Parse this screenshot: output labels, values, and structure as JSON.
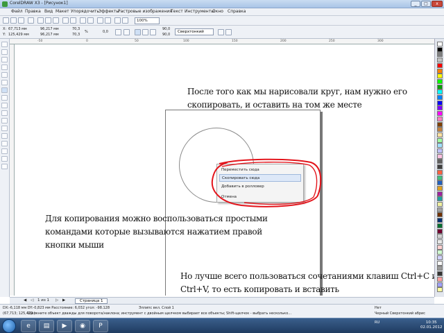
{
  "window": {
    "title": "CorelDRAW X3 - [Рисунок1]",
    "minimize": "_",
    "maximize": "□",
    "close": "x"
  },
  "menu": [
    "Файл",
    "Правка",
    "Вид",
    "Макет",
    "Упорядочить",
    "Эффекты",
    "Растровые изображения",
    "Текст",
    "Инструменты",
    "Окно",
    "Справка"
  ],
  "toolbar": {
    "zoom": "100%"
  },
  "propbar": {
    "x": "67,713 мм",
    "y": "125,429 мм",
    "w": "96,217 мм",
    "h": "96,217 мм",
    "sx": "70,3",
    "sy": "70,3",
    "angle": "0,0",
    "deg1": "90,0",
    "deg2": "90,0",
    "outline": "Сверхтонкий"
  },
  "slide": {
    "note1": "После того как мы нарисовали круг, нам нужно его скопировать, и оставить на том же месте",
    "note2": "Для копирования можно воспользоваться простыми командами которые вызываются нажатием правой кнопки мыши",
    "note3": "Но лучше всего пользоваться сочетаниями клавиш Ctrl+C и Ctrl+V, то есть копировать и вставить"
  },
  "context_menu": [
    "Переместить сюда",
    "Скопировать сюда",
    "Добавить в ролловер",
    "Отмена"
  ],
  "pagenav": {
    "counter": "1 из 1",
    "tab": "Страница 1"
  },
  "status": {
    "dims": "DX:-6,118 мм DY:-0,823 мм Расстояние: 6,032 угол: -98.128",
    "layer": "Эллипс вкл. Слой 1",
    "hint": "Щелкните объект дважды для поворота/наклона; инструмент с двойным щелчком выбирает все объекты; Shift-щелчок - выбрать несколько...",
    "coords": "(67,713; 125,429 )",
    "fill": "Нет",
    "outline": "Черный  Сверхтонкий абрис"
  },
  "tray": {
    "lang": "RU",
    "time": "10:35",
    "date": "02.01.2012"
  },
  "palette_colors": [
    "#ffffff",
    "#000000",
    "#808080",
    "#c0c0c0",
    "#ff0000",
    "#ff8000",
    "#ffff00",
    "#00ff00",
    "#00a000",
    "#00ffff",
    "#0080ff",
    "#0000ff",
    "#8000ff",
    "#ff00ff",
    "#ff80c0",
    "#804000",
    "#c08040",
    "#ffe0a0",
    "#a0ffa0",
    "#a0e0ff",
    "#c0c0ff",
    "#ffc0e0",
    "#606060",
    "#404040",
    "#ff6040",
    "#40c080",
    "#2060c0",
    "#e0a020",
    "#a020a0",
    "#20a0a0",
    "#f0f0a0",
    "#a0a0a0",
    "#703000",
    "#003070",
    "#007030",
    "#700030",
    "#d0d0d0",
    "#e8e8e8",
    "#ffd0d0",
    "#d0ffd0",
    "#d0d0ff",
    "#f8f8f8",
    "#999999",
    "#333333",
    "#ffa0a0",
    "#a0a0ff",
    "#ffffa0"
  ]
}
